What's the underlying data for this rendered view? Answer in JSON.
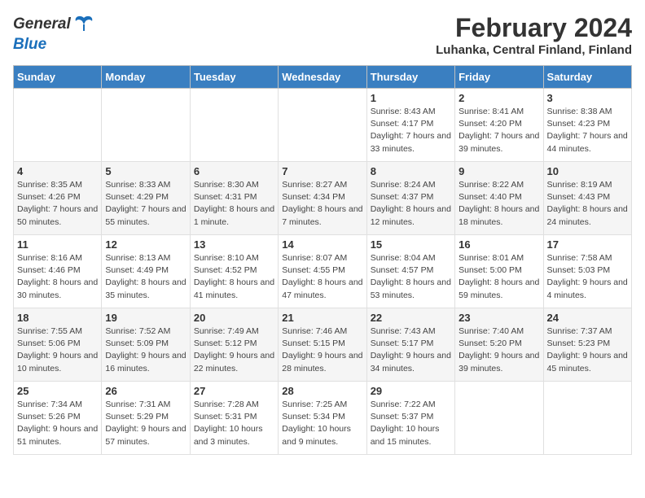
{
  "header": {
    "logo_general": "General",
    "logo_blue": "Blue",
    "title": "February 2024",
    "subtitle": "Luhanka, Central Finland, Finland"
  },
  "weekdays": [
    "Sunday",
    "Monday",
    "Tuesday",
    "Wednesday",
    "Thursday",
    "Friday",
    "Saturday"
  ],
  "weeks": [
    [
      {
        "day": "",
        "detail": ""
      },
      {
        "day": "",
        "detail": ""
      },
      {
        "day": "",
        "detail": ""
      },
      {
        "day": "",
        "detail": ""
      },
      {
        "day": "1",
        "detail": "Sunrise: 8:43 AM\nSunset: 4:17 PM\nDaylight: 7 hours\nand 33 minutes."
      },
      {
        "day": "2",
        "detail": "Sunrise: 8:41 AM\nSunset: 4:20 PM\nDaylight: 7 hours\nand 39 minutes."
      },
      {
        "day": "3",
        "detail": "Sunrise: 8:38 AM\nSunset: 4:23 PM\nDaylight: 7 hours\nand 44 minutes."
      }
    ],
    [
      {
        "day": "4",
        "detail": "Sunrise: 8:35 AM\nSunset: 4:26 PM\nDaylight: 7 hours\nand 50 minutes."
      },
      {
        "day": "5",
        "detail": "Sunrise: 8:33 AM\nSunset: 4:29 PM\nDaylight: 7 hours\nand 55 minutes."
      },
      {
        "day": "6",
        "detail": "Sunrise: 8:30 AM\nSunset: 4:31 PM\nDaylight: 8 hours\nand 1 minute."
      },
      {
        "day": "7",
        "detail": "Sunrise: 8:27 AM\nSunset: 4:34 PM\nDaylight: 8 hours\nand 7 minutes."
      },
      {
        "day": "8",
        "detail": "Sunrise: 8:24 AM\nSunset: 4:37 PM\nDaylight: 8 hours\nand 12 minutes."
      },
      {
        "day": "9",
        "detail": "Sunrise: 8:22 AM\nSunset: 4:40 PM\nDaylight: 8 hours\nand 18 minutes."
      },
      {
        "day": "10",
        "detail": "Sunrise: 8:19 AM\nSunset: 4:43 PM\nDaylight: 8 hours\nand 24 minutes."
      }
    ],
    [
      {
        "day": "11",
        "detail": "Sunrise: 8:16 AM\nSunset: 4:46 PM\nDaylight: 8 hours\nand 30 minutes."
      },
      {
        "day": "12",
        "detail": "Sunrise: 8:13 AM\nSunset: 4:49 PM\nDaylight: 8 hours\nand 35 minutes."
      },
      {
        "day": "13",
        "detail": "Sunrise: 8:10 AM\nSunset: 4:52 PM\nDaylight: 8 hours\nand 41 minutes."
      },
      {
        "day": "14",
        "detail": "Sunrise: 8:07 AM\nSunset: 4:55 PM\nDaylight: 8 hours\nand 47 minutes."
      },
      {
        "day": "15",
        "detail": "Sunrise: 8:04 AM\nSunset: 4:57 PM\nDaylight: 8 hours\nand 53 minutes."
      },
      {
        "day": "16",
        "detail": "Sunrise: 8:01 AM\nSunset: 5:00 PM\nDaylight: 8 hours\nand 59 minutes."
      },
      {
        "day": "17",
        "detail": "Sunrise: 7:58 AM\nSunset: 5:03 PM\nDaylight: 9 hours\nand 4 minutes."
      }
    ],
    [
      {
        "day": "18",
        "detail": "Sunrise: 7:55 AM\nSunset: 5:06 PM\nDaylight: 9 hours\nand 10 minutes."
      },
      {
        "day": "19",
        "detail": "Sunrise: 7:52 AM\nSunset: 5:09 PM\nDaylight: 9 hours\nand 16 minutes."
      },
      {
        "day": "20",
        "detail": "Sunrise: 7:49 AM\nSunset: 5:12 PM\nDaylight: 9 hours\nand 22 minutes."
      },
      {
        "day": "21",
        "detail": "Sunrise: 7:46 AM\nSunset: 5:15 PM\nDaylight: 9 hours\nand 28 minutes."
      },
      {
        "day": "22",
        "detail": "Sunrise: 7:43 AM\nSunset: 5:17 PM\nDaylight: 9 hours\nand 34 minutes."
      },
      {
        "day": "23",
        "detail": "Sunrise: 7:40 AM\nSunset: 5:20 PM\nDaylight: 9 hours\nand 39 minutes."
      },
      {
        "day": "24",
        "detail": "Sunrise: 7:37 AM\nSunset: 5:23 PM\nDaylight: 9 hours\nand 45 minutes."
      }
    ],
    [
      {
        "day": "25",
        "detail": "Sunrise: 7:34 AM\nSunset: 5:26 PM\nDaylight: 9 hours\nand 51 minutes."
      },
      {
        "day": "26",
        "detail": "Sunrise: 7:31 AM\nSunset: 5:29 PM\nDaylight: 9 hours\nand 57 minutes."
      },
      {
        "day": "27",
        "detail": "Sunrise: 7:28 AM\nSunset: 5:31 PM\nDaylight: 10 hours\nand 3 minutes."
      },
      {
        "day": "28",
        "detail": "Sunrise: 7:25 AM\nSunset: 5:34 PM\nDaylight: 10 hours\nand 9 minutes."
      },
      {
        "day": "29",
        "detail": "Sunrise: 7:22 AM\nSunset: 5:37 PM\nDaylight: 10 hours\nand 15 minutes."
      },
      {
        "day": "",
        "detail": ""
      },
      {
        "day": "",
        "detail": ""
      }
    ]
  ]
}
